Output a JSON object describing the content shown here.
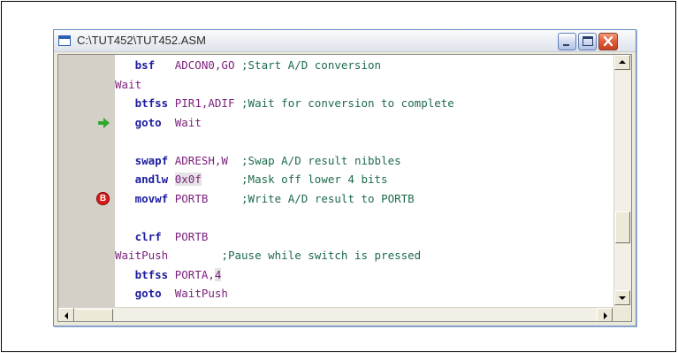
{
  "window": {
    "title": "C:\\TUT452\\TUT452.ASM"
  },
  "code_lines": [
    {
      "indent": "   ",
      "mnemonic": "bsf",
      "args": "ADCON0,GO",
      "comment": ";Start A/D conversion"
    },
    {
      "label": "Wait"
    },
    {
      "indent": "   ",
      "mnemonic": "btfss",
      "args": "PIR1,ADIF",
      "comment": ";Wait for conversion to complete"
    },
    {
      "indent": "   ",
      "mnemonic": "goto",
      "args": "Wait",
      "marker": "execution-arrow"
    },
    {},
    {
      "indent": "   ",
      "mnemonic": "swapf",
      "args": "ADRESH,W",
      "comment": ";Swap A/D result nibbles"
    },
    {
      "indent": "   ",
      "mnemonic": "andlw",
      "args": "0x0f",
      "comment": ";Mask off lower 4 bits",
      "highlight": "0x0f"
    },
    {
      "indent": "   ",
      "mnemonic": "movwf",
      "args": "PORTB",
      "comment": ";Write A/D result to PORTB",
      "marker": "breakpoint"
    },
    {},
    {
      "indent": "   ",
      "mnemonic": "clrf",
      "args": "PORTB"
    },
    {
      "label": "WaitPush",
      "comment": ";Pause while switch is pressed"
    },
    {
      "indent": "   ",
      "mnemonic": "btfss",
      "args": "PORTA,4",
      "highlight": "4"
    },
    {
      "indent": "   ",
      "mnemonic": "goto",
      "args": "WaitPush"
    }
  ],
  "markers": {
    "breakpoint_letter": "B"
  },
  "scrollbars": {
    "vertical_position": 0.75,
    "horizontal_position": 0.0
  },
  "icons": {
    "execution": "green-arrow-icon",
    "breakpoint": "red-breakpoint-icon",
    "minimize": "minimize-icon",
    "maximize": "maximize-icon",
    "close": "close-icon"
  }
}
